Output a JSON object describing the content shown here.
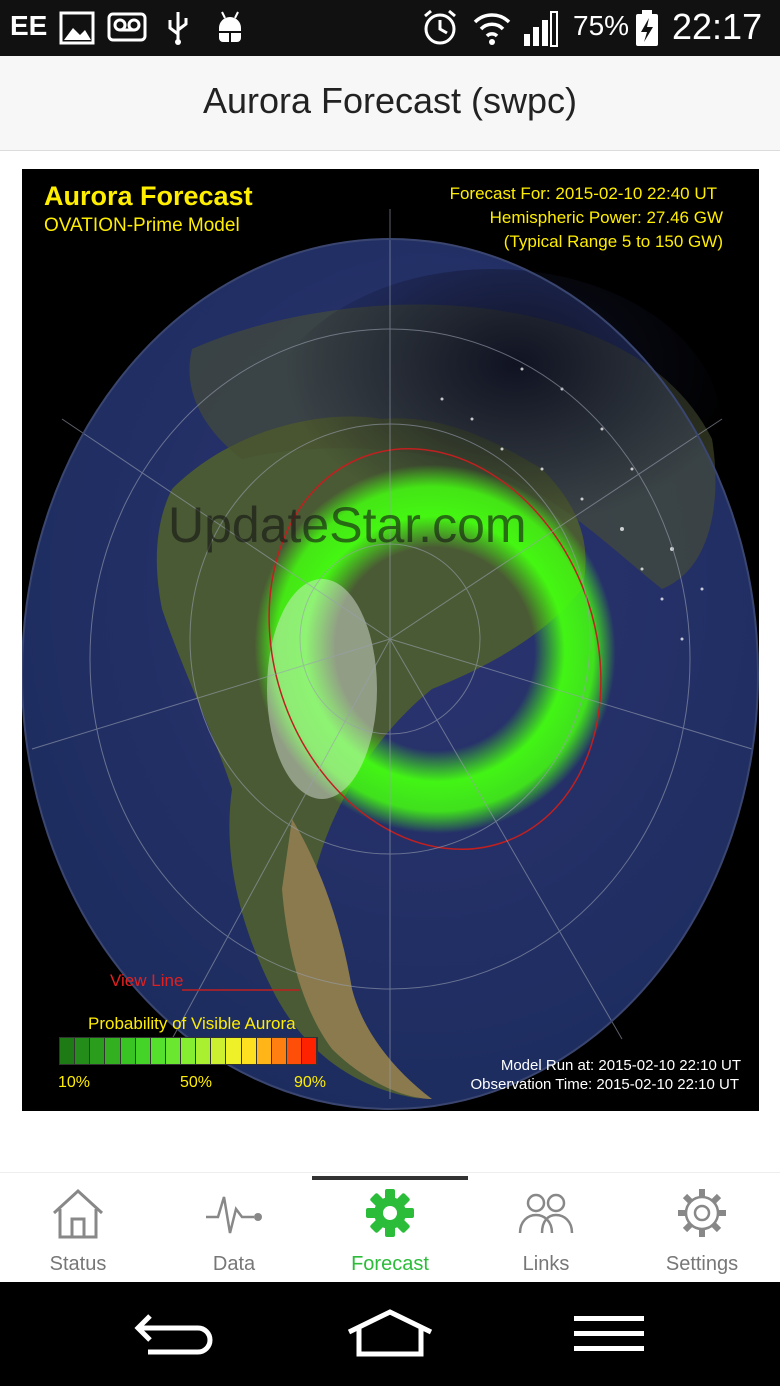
{
  "status_bar": {
    "carrier": "EE",
    "battery_percent": "75%",
    "time": "22:17",
    "icons": [
      "image-icon",
      "voicemail-icon",
      "usb-icon",
      "android-debug-icon",
      "alarm-icon",
      "wifi-icon",
      "signal-icon",
      "battery-charging-icon"
    ]
  },
  "app_bar": {
    "title": "Aurora Forecast (swpc)"
  },
  "forecast_map": {
    "title": "Aurora Forecast",
    "model": "OVATION-Prime Model",
    "forecast_for": "Forecast For: 2015-02-10 22:40 UT",
    "hemispheric_power": "Hemispheric Power: 27.46 GW",
    "typical_range": "(Typical Range 5 to 150 GW)",
    "view_line_label": "View Line",
    "probability_title": "Probability of Visible Aurora",
    "scale_labels": [
      "10%",
      "50%",
      "90%"
    ],
    "colorbar_colors": [
      "#1e7a14",
      "#248c18",
      "#2a9e1c",
      "#32b020",
      "#3ac424",
      "#44d428",
      "#54e02c",
      "#6ae830",
      "#86ee30",
      "#a8f030",
      "#ccf030",
      "#eef028",
      "#ffe020",
      "#ffb418",
      "#ff8010",
      "#ff4e08",
      "#ff2200"
    ],
    "model_run": "Model Run at: 2015-02-10 22:10 UT",
    "observation_time": "Observation Time: 2015-02-10 22:10 UT",
    "watermark": "UpdateStar.com"
  },
  "tabs": [
    {
      "label": "Status",
      "icon": "house-icon",
      "active": false
    },
    {
      "label": "Data",
      "icon": "pulse-icon",
      "active": false
    },
    {
      "label": "Forecast",
      "icon": "gear-icon",
      "active": true
    },
    {
      "label": "Links",
      "icon": "people-icon",
      "active": false
    },
    {
      "label": "Settings",
      "icon": "settings-gear-icon",
      "active": false
    }
  ],
  "nav_bar": {
    "buttons": [
      "back-icon",
      "home-icon",
      "menu-icon"
    ]
  }
}
